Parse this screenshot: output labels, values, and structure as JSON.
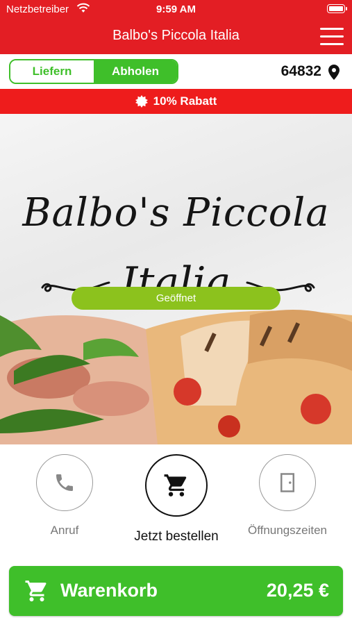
{
  "status": {
    "carrier": "Netzbetreiber",
    "time": "9:59 AM"
  },
  "nav": {
    "title": "Balbo's Piccola Italia"
  },
  "mode": {
    "deliver_label": "Liefern",
    "pickup_label": "Abholen",
    "postal_code": "64832"
  },
  "discount": {
    "label": "10% Rabatt"
  },
  "hero": {
    "logo_line1": "Balbo's Piccola",
    "logo_line2": "Italia",
    "open_status": "Geöffnet"
  },
  "actions": {
    "call_label": "Anruf",
    "order_label": "Jetzt bestellen",
    "hours_label": "Öffnungszeiten"
  },
  "cart": {
    "label": "Warenkorb",
    "total": "20,25 €"
  },
  "colors": {
    "brand_red": "#e31e24",
    "accent_green": "#3fbf2a",
    "open_green": "#8cc21d"
  }
}
